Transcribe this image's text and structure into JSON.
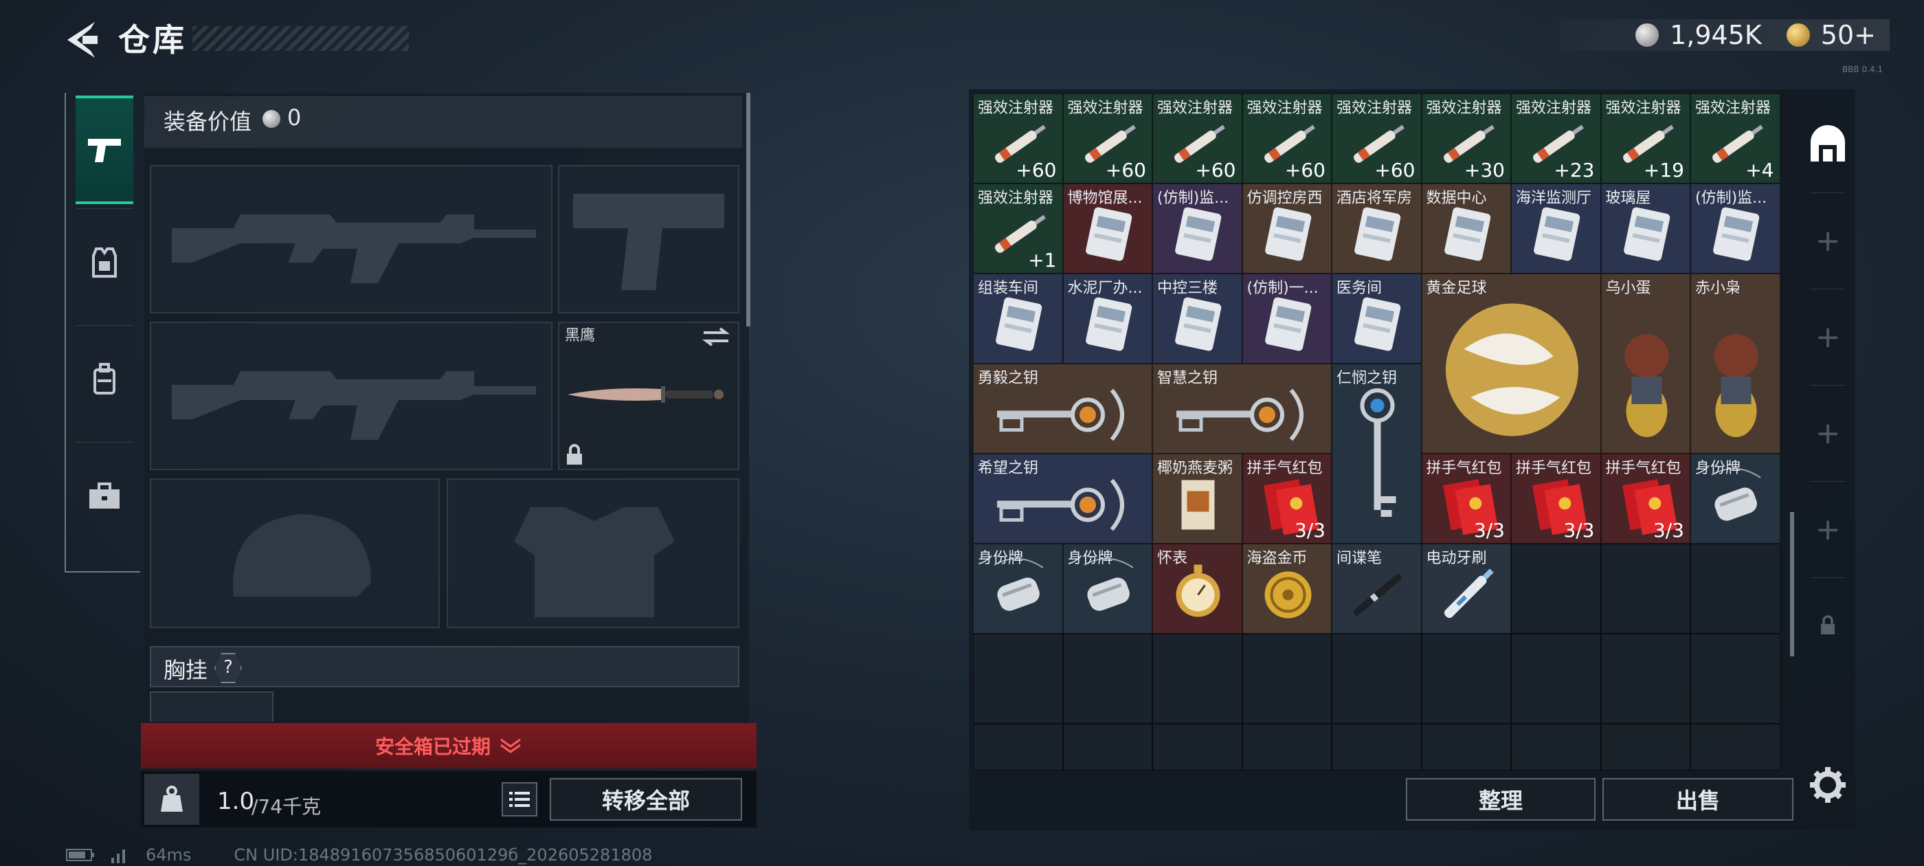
{
  "header": {
    "title": "仓库",
    "currency": [
      {
        "icon": "silver-coin-icon",
        "value": "1,945K"
      },
      {
        "icon": "gold-coin-icon",
        "value": "50+"
      }
    ],
    "tiny_tag": "BBB 0.4.1"
  },
  "side_nav": [
    {
      "icon": "pistol-icon",
      "active": true
    },
    {
      "icon": "armor-icon",
      "active": false
    },
    {
      "icon": "backpack-icon",
      "active": false
    },
    {
      "icon": "briefcase-icon",
      "active": false
    }
  ],
  "equipment": {
    "label": "装备价值",
    "value": "0",
    "knife_name": "黑鹰",
    "chest_label": "胸挂",
    "chest_help": "?",
    "safebox_text": "安全箱已过期",
    "weight_value": "1.0",
    "weight_unit": "/74千克",
    "transfer_label": "转移全部"
  },
  "status": {
    "ping": "64ms",
    "uid": "CN UID:18489160735685060129б_202605281808"
  },
  "storage": {
    "items": [
      {
        "name": "强效注射器",
        "count": "+60",
        "color": "green",
        "art": "syringe"
      },
      {
        "name": "强效注射器",
        "count": "+60",
        "color": "green",
        "art": "syringe"
      },
      {
        "name": "强效注射器",
        "count": "+60",
        "color": "green",
        "art": "syringe"
      },
      {
        "name": "强效注射器",
        "count": "+60",
        "color": "green",
        "art": "syringe"
      },
      {
        "name": "强效注射器",
        "count": "+60",
        "color": "green",
        "art": "syringe"
      },
      {
        "name": "强效注射器",
        "count": "+30",
        "color": "green",
        "art": "syringe"
      },
      {
        "name": "强效注射器",
        "count": "+23",
        "color": "green",
        "art": "syringe"
      },
      {
        "name": "强效注射器",
        "count": "+19",
        "color": "green",
        "art": "syringe"
      },
      {
        "name": "强效注射器",
        "count": "+4",
        "color": "green",
        "art": "syringe"
      },
      {
        "name": "强效注射器",
        "count": "+1",
        "color": "green",
        "art": "syringe"
      },
      {
        "name": "博物馆展...",
        "count": "",
        "color": "red",
        "art": "card"
      },
      {
        "name": "(仿制)监...",
        "count": "",
        "color": "purple",
        "art": "card"
      },
      {
        "name": "仿调控房西",
        "count": "",
        "color": "brown",
        "art": "card"
      },
      {
        "name": "酒店将军房",
        "count": "",
        "color": "brown",
        "art": "card"
      },
      {
        "name": "数据中心",
        "count": "",
        "color": "brown",
        "art": "card"
      },
      {
        "name": "海洋监测厅",
        "count": "",
        "color": "blue",
        "art": "card"
      },
      {
        "name": "玻璃屋",
        "count": "",
        "color": "blue",
        "art": "card"
      },
      {
        "name": "(仿制)监...",
        "count": "",
        "color": "blue",
        "art": "card"
      },
      {
        "name": "组装车间",
        "count": "",
        "color": "blue",
        "art": "card"
      },
      {
        "name": "水泥厂办...",
        "count": "",
        "color": "blue",
        "art": "card"
      },
      {
        "name": "中控三楼",
        "count": "",
        "color": "blue",
        "art": "card"
      },
      {
        "name": "(仿制)一...",
        "count": "",
        "color": "purple",
        "art": "card"
      },
      {
        "name": "医务间",
        "count": "",
        "color": "blue",
        "art": "card"
      },
      {
        "name": "黄金足球",
        "count": "",
        "color": "brown",
        "art": "ball"
      },
      {
        "name": "乌小蛋",
        "count": "",
        "color": "brown",
        "art": "figure"
      },
      {
        "name": "赤小枭",
        "count": "",
        "color": "brown",
        "art": "figure"
      },
      {
        "name": "勇毅之钥",
        "count": "",
        "color": "brown",
        "art": "key"
      },
      {
        "name": "智慧之钥",
        "count": "",
        "color": "brown",
        "art": "key"
      },
      {
        "name": "仁悯之钥",
        "count": "",
        "color": "steel",
        "art": "vkey"
      },
      {
        "name": "希望之钥",
        "count": "",
        "color": "blue",
        "art": "key"
      },
      {
        "name": "椰奶燕麦粥",
        "count": "",
        "color": "brown",
        "art": "pack"
      },
      {
        "name": "拼手气红包",
        "count": "3/3",
        "color": "red",
        "art": "envelope"
      },
      {
        "name": "拼手气红包",
        "count": "3/3",
        "color": "red",
        "art": "envelope"
      },
      {
        "name": "拼手气红包",
        "count": "3/3",
        "color": "red",
        "art": "envelope"
      },
      {
        "name": "拼手气红包",
        "count": "3/3",
        "color": "red",
        "art": "envelope"
      },
      {
        "name": "身份牌",
        "count": "",
        "color": "steel",
        "art": "tag"
      },
      {
        "name": "身份牌",
        "count": "",
        "color": "steel",
        "art": "tag"
      },
      {
        "name": "身份牌",
        "count": "",
        "color": "steel",
        "art": "tag"
      },
      {
        "name": "怀表",
        "count": "",
        "color": "red",
        "art": "watch"
      },
      {
        "name": "海盗金币",
        "count": "",
        "color": "brown",
        "art": "coin"
      },
      {
        "name": "间谍笔",
        "count": "",
        "color": "gray",
        "art": "pen"
      },
      {
        "name": "电动牙刷",
        "count": "",
        "color": "gray",
        "art": "brush"
      }
    ],
    "sort_label": "整理",
    "sell_label": "出售"
  },
  "right_tabs": [
    {
      "icon": "storage-icon",
      "label": ""
    },
    {
      "icon": "add-icon",
      "label": "+"
    },
    {
      "icon": "add-icon",
      "label": "+"
    },
    {
      "icon": "add-icon",
      "label": "+"
    },
    {
      "icon": "add-icon",
      "label": "+"
    },
    {
      "icon": "lock-icon",
      "label": ""
    }
  ]
}
